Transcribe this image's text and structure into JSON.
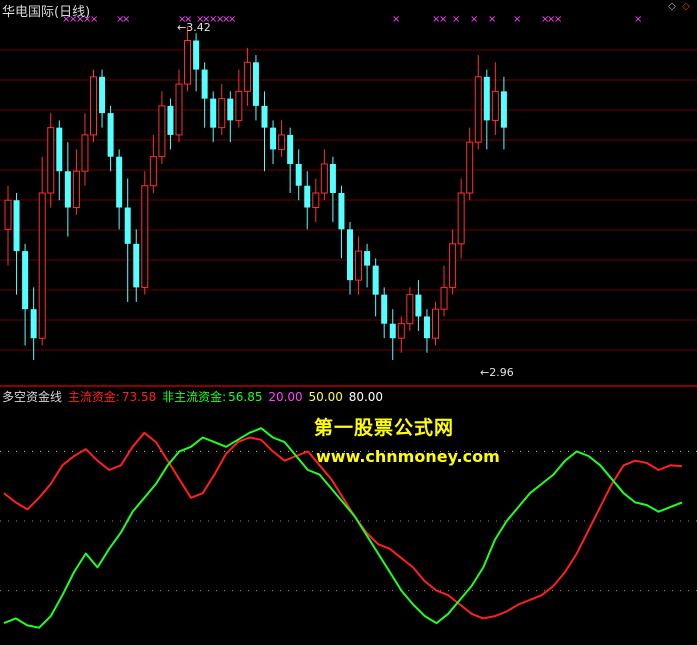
{
  "upper_panel": {
    "title": "华电国际(日线)",
    "high_label": "3.42",
    "low_label": "2.96",
    "high_marker": "←",
    "low_marker": "←",
    "colors": {
      "up": "#ff3030",
      "down": "#54ffff",
      "grid": "#6b0000",
      "signal": "#ff44ff",
      "text": "#e0e0e0"
    },
    "controls": [
      "◇",
      "◇"
    ]
  },
  "lower_panel": {
    "indicator_name": "多空资金线",
    "main_label": "主流资金:",
    "main_value": "73.58",
    "non_main_label": "非主流资金:",
    "non_main_value": "56.85",
    "level_20": "20.00",
    "level_50": "50.00",
    "level_80": "80.00",
    "colors": {
      "main": "#ff2020",
      "non_main": "#20ff20",
      "level_20": "#ff44ff",
      "level_50": "#ffff40",
      "level_80": "#ffffff",
      "dots": "#bbbbbb"
    },
    "watermark_title": "第一股票公式网",
    "watermark_url": "www.chnmoney.com"
  },
  "chart_data": [
    {
      "type": "candlestick",
      "title": "华电国际(日线)",
      "y_high_label": 3.42,
      "y_low_label": 2.96,
      "candles": [
        {
          "o": 3.14,
          "c": 3.18,
          "h": 3.2,
          "l": 3.09
        },
        {
          "o": 3.18,
          "c": 3.11,
          "h": 3.19,
          "l": 3.05
        },
        {
          "o": 3.11,
          "c": 3.03,
          "h": 3.12,
          "l": 2.98
        },
        {
          "o": 3.03,
          "c": 2.99,
          "h": 3.06,
          "l": 2.96
        },
        {
          "o": 2.99,
          "c": 3.19,
          "h": 3.24,
          "l": 2.98
        },
        {
          "o": 3.19,
          "c": 3.28,
          "h": 3.3,
          "l": 3.17
        },
        {
          "o": 3.28,
          "c": 3.22,
          "h": 3.29,
          "l": 3.18
        },
        {
          "o": 3.22,
          "c": 3.17,
          "h": 3.26,
          "l": 3.13
        },
        {
          "o": 3.17,
          "c": 3.22,
          "h": 3.25,
          "l": 3.16
        },
        {
          "o": 3.22,
          "c": 3.27,
          "h": 3.3,
          "l": 3.2
        },
        {
          "o": 3.27,
          "c": 3.35,
          "h": 3.36,
          "l": 3.26
        },
        {
          "o": 3.35,
          "c": 3.3,
          "h": 3.36,
          "l": 3.28
        },
        {
          "o": 3.3,
          "c": 3.24,
          "h": 3.31,
          "l": 3.22
        },
        {
          "o": 3.24,
          "c": 3.17,
          "h": 3.25,
          "l": 3.14
        },
        {
          "o": 3.17,
          "c": 3.12,
          "h": 3.21,
          "l": 3.04
        },
        {
          "o": 3.12,
          "c": 3.06,
          "h": 3.14,
          "l": 3.04
        },
        {
          "o": 3.06,
          "c": 3.2,
          "h": 3.22,
          "l": 3.05
        },
        {
          "o": 3.2,
          "c": 3.24,
          "h": 3.27,
          "l": 3.19
        },
        {
          "o": 3.24,
          "c": 3.31,
          "h": 3.33,
          "l": 3.23
        },
        {
          "o": 3.31,
          "c": 3.27,
          "h": 3.32,
          "l": 3.25
        },
        {
          "o": 3.27,
          "c": 3.34,
          "h": 3.36,
          "l": 3.26
        },
        {
          "o": 3.34,
          "c": 3.4,
          "h": 3.42,
          "l": 3.33
        },
        {
          "o": 3.4,
          "c": 3.36,
          "h": 3.41,
          "l": 3.33
        },
        {
          "o": 3.36,
          "c": 3.32,
          "h": 3.37,
          "l": 3.28
        },
        {
          "o": 3.32,
          "c": 3.28,
          "h": 3.33,
          "l": 3.26
        },
        {
          "o": 3.28,
          "c": 3.32,
          "h": 3.34,
          "l": 3.27
        },
        {
          "o": 3.32,
          "c": 3.29,
          "h": 3.33,
          "l": 3.26
        },
        {
          "o": 3.29,
          "c": 3.33,
          "h": 3.36,
          "l": 3.28
        },
        {
          "o": 3.33,
          "c": 3.37,
          "h": 3.39,
          "l": 3.31
        },
        {
          "o": 3.37,
          "c": 3.31,
          "h": 3.38,
          "l": 3.29
        },
        {
          "o": 3.31,
          "c": 3.28,
          "h": 3.33,
          "l": 3.22
        },
        {
          "o": 3.28,
          "c": 3.25,
          "h": 3.29,
          "l": 3.23
        },
        {
          "o": 3.25,
          "c": 3.27,
          "h": 3.29,
          "l": 3.24
        },
        {
          "o": 3.27,
          "c": 3.23,
          "h": 3.28,
          "l": 3.19
        },
        {
          "o": 3.23,
          "c": 3.2,
          "h": 3.25,
          "l": 3.18
        },
        {
          "o": 3.2,
          "c": 3.17,
          "h": 3.22,
          "l": 3.14
        },
        {
          "o": 3.17,
          "c": 3.19,
          "h": 3.21,
          "l": 3.15
        },
        {
          "o": 3.19,
          "c": 3.23,
          "h": 3.25,
          "l": 3.18
        },
        {
          "o": 3.23,
          "c": 3.19,
          "h": 3.24,
          "l": 3.15
        },
        {
          "o": 3.19,
          "c": 3.14,
          "h": 3.2,
          "l": 3.1
        },
        {
          "o": 3.14,
          "c": 3.07,
          "h": 3.15,
          "l": 3.05
        },
        {
          "o": 3.07,
          "c": 3.11,
          "h": 3.13,
          "l": 3.05
        },
        {
          "o": 3.11,
          "c": 3.09,
          "h": 3.12,
          "l": 3.06
        },
        {
          "o": 3.09,
          "c": 3.05,
          "h": 3.1,
          "l": 3.02
        },
        {
          "o": 3.05,
          "c": 3.01,
          "h": 3.06,
          "l": 2.99
        },
        {
          "o": 3.01,
          "c": 2.99,
          "h": 3.03,
          "l": 2.96
        },
        {
          "o": 2.99,
          "c": 3.01,
          "h": 3.02,
          "l": 2.97
        },
        {
          "o": 3.01,
          "c": 3.05,
          "h": 3.06,
          "l": 3.0
        },
        {
          "o": 3.05,
          "c": 3.02,
          "h": 3.07,
          "l": 3.0
        },
        {
          "o": 3.02,
          "c": 2.99,
          "h": 3.03,
          "l": 2.97
        },
        {
          "o": 2.99,
          "c": 3.03,
          "h": 3.04,
          "l": 2.98
        },
        {
          "o": 3.03,
          "c": 3.06,
          "h": 3.09,
          "l": 3.02
        },
        {
          "o": 3.06,
          "c": 3.12,
          "h": 3.14,
          "l": 3.05
        },
        {
          "o": 3.12,
          "c": 3.19,
          "h": 3.21,
          "l": 3.1
        },
        {
          "o": 3.19,
          "c": 3.26,
          "h": 3.28,
          "l": 3.18
        },
        {
          "o": 3.26,
          "c": 3.35,
          "h": 3.38,
          "l": 3.25
        },
        {
          "o": 3.35,
          "c": 3.29,
          "h": 3.36,
          "l": 3.25
        },
        {
          "o": 3.29,
          "c": 3.33,
          "h": 3.37,
          "l": 3.27
        },
        {
          "o": 3.33,
          "c": 3.28,
          "h": 3.35,
          "l": 3.25
        }
      ]
    },
    {
      "type": "line",
      "title": "多空资金线",
      "ylim": [
        0,
        100
      ],
      "levels": [
        20,
        50,
        80
      ],
      "series": [
        {
          "name": "主流资金",
          "values": [
            62,
            58,
            55,
            60,
            66,
            74,
            78,
            81,
            76,
            72,
            74,
            82,
            88,
            84,
            76,
            68,
            60,
            62,
            70,
            79,
            84,
            86,
            85,
            80,
            76,
            78,
            80,
            74,
            68,
            60,
            52,
            45,
            40,
            38,
            34,
            30,
            24,
            20,
            18,
            14,
            10,
            8,
            9,
            11,
            14,
            16,
            18,
            22,
            28,
            36,
            46,
            56,
            66,
            74,
            76,
            75,
            72,
            74,
            73.58
          ]
        },
        {
          "name": "非主流资金",
          "values": [
            6,
            8,
            5,
            4,
            9,
            18,
            28,
            36,
            30,
            38,
            45,
            54,
            60,
            66,
            74,
            80,
            82,
            86,
            84,
            82,
            85,
            88,
            90,
            86,
            84,
            78,
            72,
            70,
            64,
            58,
            52,
            44,
            36,
            28,
            20,
            14,
            9,
            6,
            10,
            16,
            22,
            30,
            42,
            50,
            56,
            62,
            66,
            70,
            76,
            80,
            78,
            74,
            68,
            62,
            58,
            56.85,
            54,
            56,
            58
          ]
        }
      ]
    }
  ]
}
